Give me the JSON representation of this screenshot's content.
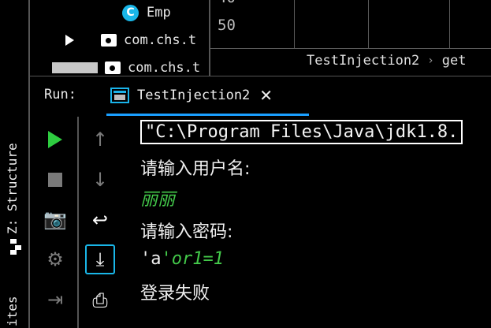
{
  "tree": {
    "class_item": {
      "badge": "C",
      "label": "Emp"
    },
    "pkg_item_1": {
      "label": "com.chs.t"
    },
    "pkg_item_2": {
      "label": "com.chs.t"
    }
  },
  "editor": {
    "line_number": "50",
    "breadcrumb": [
      "TestInjection2",
      "get"
    ]
  },
  "run": {
    "label": "Run:",
    "tab_label": "TestInjection2"
  },
  "side": {
    "structure_label": "Z: Structure",
    "favorites_label": "ites"
  },
  "console": {
    "command": "\"C:\\Program Files\\Java\\jdk1.8.",
    "prompt_user": "请输入用户名:",
    "input_user": "丽丽",
    "prompt_pwd": "请输入密码:",
    "input_pwd_quote": "'a",
    "input_pwd_rest": "'or1=1",
    "result": "登录失败"
  },
  "colors": {
    "accent": "#19b6e8",
    "tab_underline": "#1a9fff",
    "run_green": "#2ecc40",
    "input_green": "#43c94a"
  }
}
